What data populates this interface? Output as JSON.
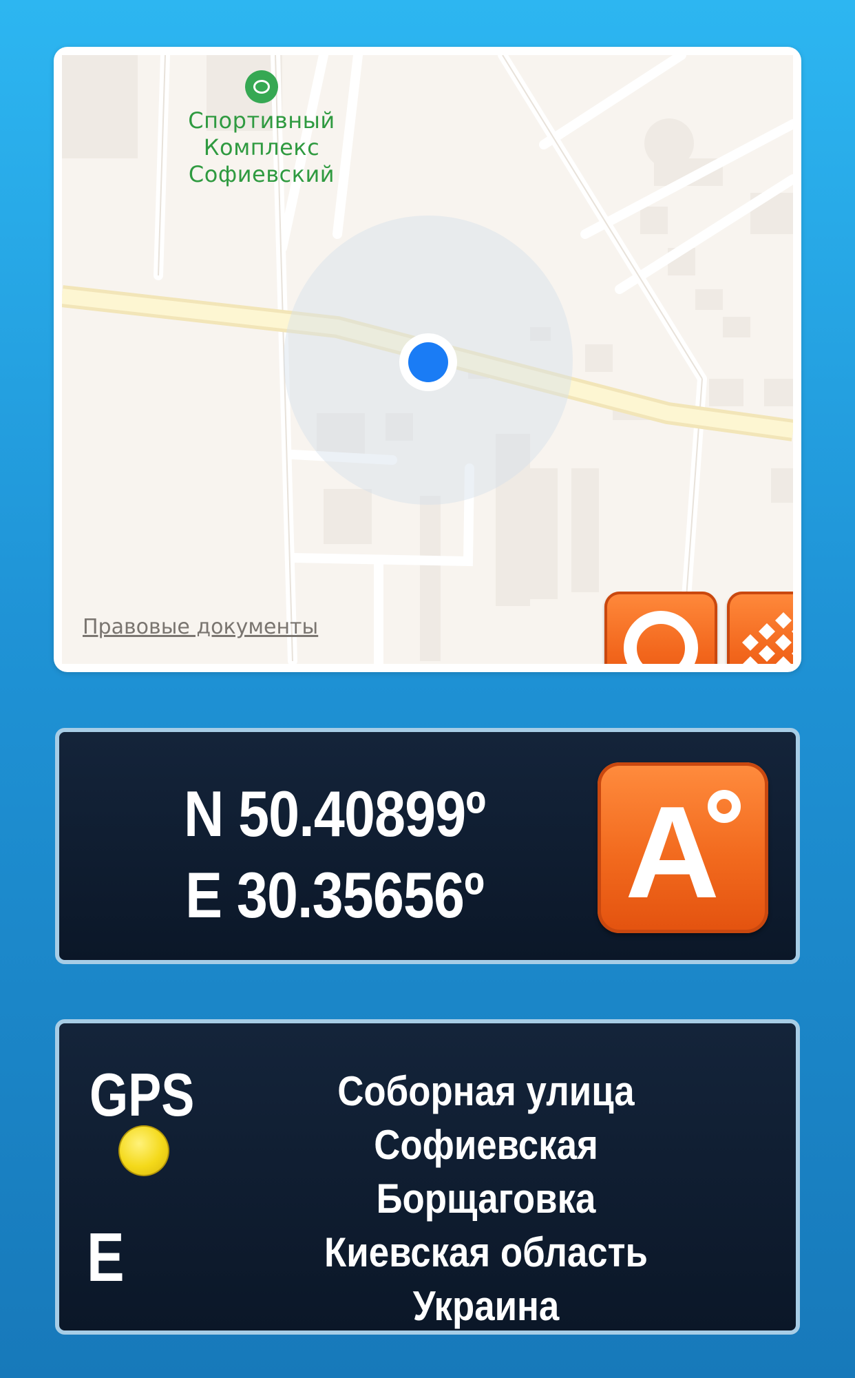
{
  "map": {
    "poi_label": "Спортивный\nКомплекс\nСофиевский",
    "poi_icon": "stadium-icon",
    "legal_link": "Правовые документы",
    "record_button_icon": "record-circle-icon",
    "map_type_button_icon": "diamond-grid-icon",
    "location_marker_icon": "current-location-icon"
  },
  "coordinates": {
    "latitude": "N 50.40899º",
    "longitude": "E 30.35656º",
    "format_button_letter": "A",
    "format_button_icon": "degree-format-icon"
  },
  "status": {
    "gps_label": "GPS",
    "gps_indicator_color": "#f4d91a",
    "direction": "E"
  },
  "address": {
    "street": "Соборная улица",
    "locality": "Софиевская Борщаговка",
    "region": "Киевская область",
    "country": "Украина"
  },
  "colors": {
    "accent": "#f26a1e",
    "panel": "#0f1e31",
    "background": "#1f93d6"
  }
}
